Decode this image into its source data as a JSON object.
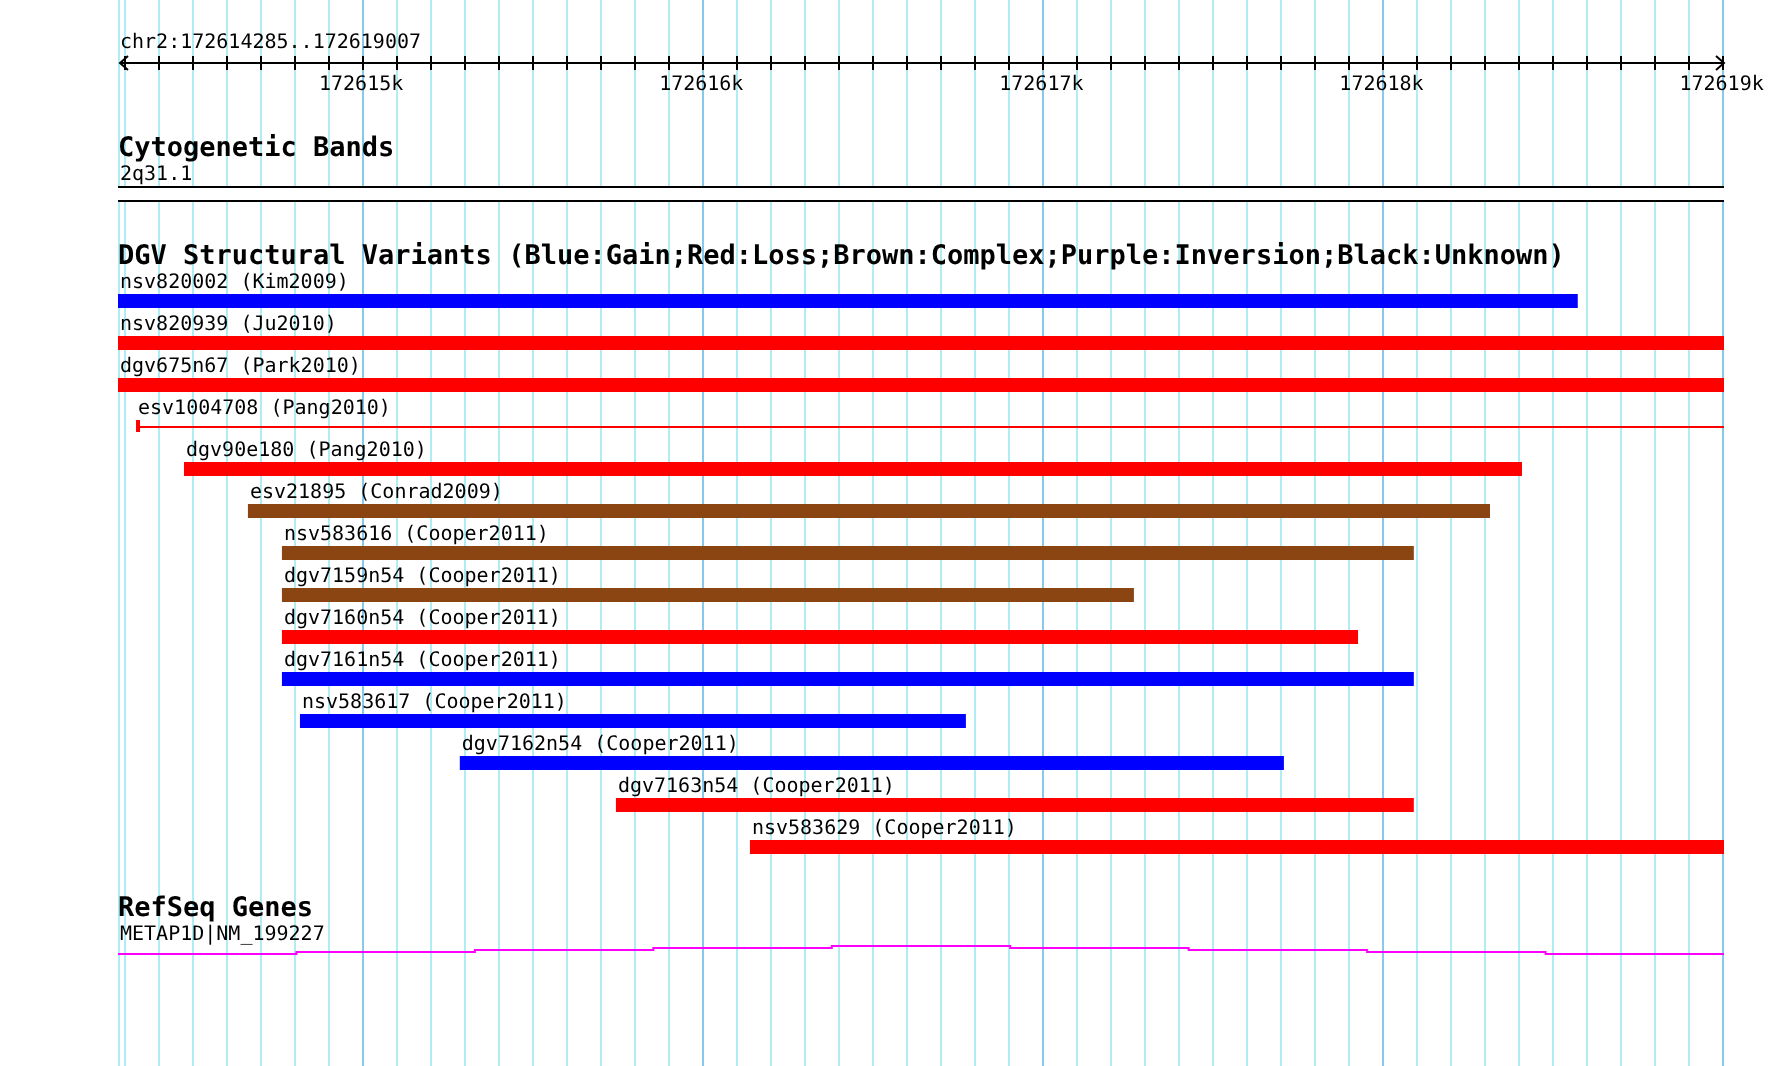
{
  "ruler": {
    "label": "chr2:172614285..172619007",
    "ticks": [
      {
        "label": "172615k"
      },
      {
        "label": "172616k"
      },
      {
        "label": "172617k"
      },
      {
        "label": "172618k"
      },
      {
        "label": "172619k"
      }
    ]
  },
  "cytoband_track": {
    "title": "Cytogenetic Bands",
    "band": "2q31.1"
  },
  "variant_track": {
    "title": "DGV Structural Variants (Blue:Gain;Red:Loss;Brown:Complex;Purple:Inversion;Black:Unknown)",
    "variants": [
      {
        "label": "nsv820002 (Kim2009)",
        "kind": "bar",
        "color": "#0000ff"
      },
      {
        "label": "nsv820939 (Ju2010)",
        "kind": "bar",
        "color": "#ff0000"
      },
      {
        "label": "dgv675n67 (Park2010)",
        "kind": "bar",
        "color": "#ff0000"
      },
      {
        "label": "esv1004708 (Pang2010)",
        "kind": "line",
        "color": "#ff0000"
      },
      {
        "label": "dgv90e180 (Pang2010)",
        "kind": "bar",
        "color": "#ff0000"
      },
      {
        "label": "esv21895 (Conrad2009)",
        "kind": "bar",
        "color": "#8b4513"
      },
      {
        "label": "nsv583616 (Cooper2011)",
        "kind": "bar",
        "color": "#8b4513"
      },
      {
        "label": "dgv7159n54 (Cooper2011)",
        "kind": "bar",
        "color": "#8b4513"
      },
      {
        "label": "dgv7160n54 (Cooper2011)",
        "kind": "bar",
        "color": "#ff0000"
      },
      {
        "label": "dgv7161n54 (Cooper2011)",
        "kind": "bar",
        "color": "#0000ff"
      },
      {
        "label": "nsv583617 (Cooper2011)",
        "kind": "bar",
        "color": "#0000ff"
      },
      {
        "label": "dgv7162n54 (Cooper2011)",
        "kind": "bar",
        "color": "#0000ff"
      },
      {
        "label": "dgv7163n54 (Cooper2011)",
        "kind": "bar",
        "color": "#ff0000"
      },
      {
        "label": "nsv583629 (Cooper2011)",
        "kind": "bar",
        "color": "#ff0000"
      }
    ]
  },
  "gene_track": {
    "title": "RefSeq Genes",
    "gene": "METAP1D|NM_199227"
  }
}
